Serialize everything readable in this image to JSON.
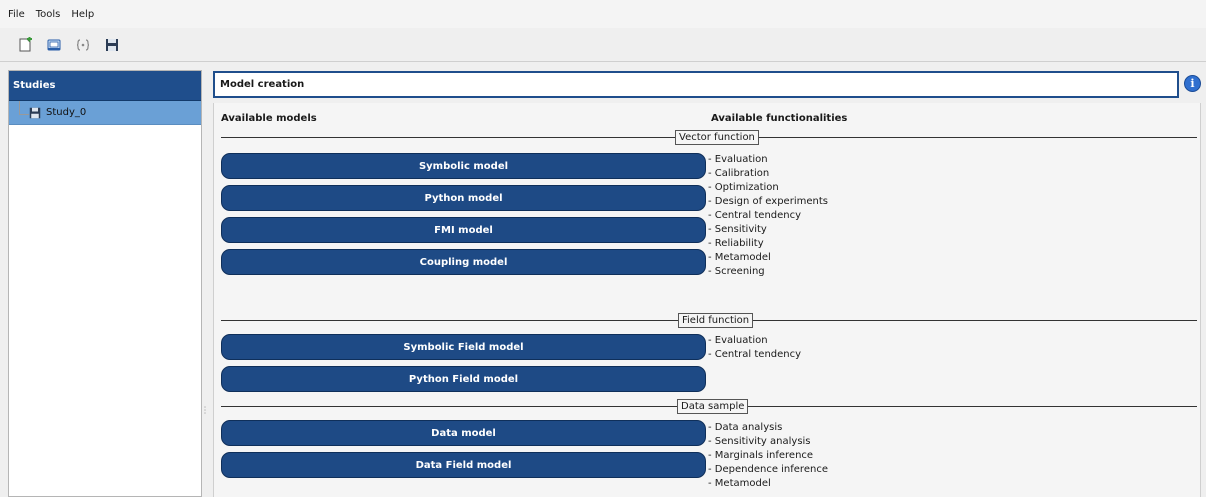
{
  "menubar": {
    "items": [
      {
        "label": "File"
      },
      {
        "label": "Tools"
      },
      {
        "label": "Help"
      }
    ]
  },
  "toolbar": {
    "buttons": [
      {
        "icon": "new-study-icon"
      },
      {
        "icon": "open-study-icon"
      },
      {
        "icon": "import-script-icon"
      },
      {
        "icon": "save-icon"
      }
    ]
  },
  "studies": {
    "header": "Studies",
    "items": [
      {
        "label": "Study_0",
        "icon": "save-icon"
      }
    ]
  },
  "window": {
    "title": "Model creation"
  },
  "main": {
    "available_models_header": "Available models",
    "available_functionalities_header": "Available functionalities",
    "sections": [
      {
        "label": "Vector function",
        "models": [
          "Symbolic model",
          "Python model",
          "FMI model",
          "Coupling model"
        ],
        "functionalities": [
          "- Evaluation",
          "- Calibration",
          "- Optimization",
          "- Design of experiments",
          "- Central tendency",
          "- Sensitivity",
          "- Reliability",
          "- Metamodel",
          "- Screening"
        ]
      },
      {
        "label": "Field function",
        "models": [
          "Symbolic Field model",
          "Python Field model"
        ],
        "functionalities": [
          "- Evaluation",
          "- Central tendency"
        ]
      },
      {
        "label": "Data sample",
        "models": [
          "Data model",
          "Data Field model"
        ],
        "functionalities": [
          "- Data analysis",
          "- Sensitivity analysis",
          "- Marginals inference",
          "- Dependence inference",
          "- Metamodel"
        ]
      }
    ]
  },
  "colors": {
    "accent": "#1f4e8c",
    "button": "#1e4a85",
    "selection": "#6aa0d6"
  }
}
